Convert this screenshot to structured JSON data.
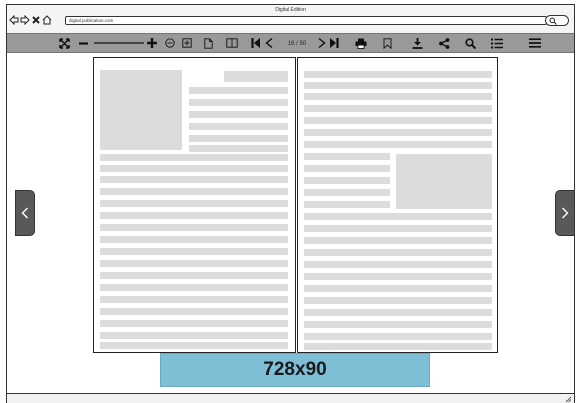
{
  "window": {
    "title": "Digital Edition"
  },
  "browser": {
    "url": "digital.publication.com",
    "nav_icons": [
      "back-arrow-icon",
      "forward-arrow-icon",
      "close-x-icon",
      "home-icon"
    ],
    "search_icon": "search-icon"
  },
  "toolbar": {
    "page_indicator": "16 / 50",
    "icons": [
      "fullscreen-icon",
      "zoom-out-icon",
      "zoom-slider",
      "zoom-in-icon",
      "zoom-minus-box-icon",
      "zoom-plus-box-icon",
      "single-page-icon",
      "double-page-icon",
      "first-page-icon",
      "previous-page-icon",
      "next-page-icon",
      "last-page-icon",
      "print-icon",
      "bookmark-icon",
      "download-icon",
      "share-icon",
      "search-icon",
      "table-of-contents-icon",
      "menu-icon"
    ],
    "background": "#999999"
  },
  "viewer": {
    "prev_icon": "chevron-left-icon",
    "next_icon": "chevron-right-icon",
    "arrow_color": "#595959"
  },
  "ad": {
    "label": "728x90",
    "color": "#7fbfd6"
  }
}
